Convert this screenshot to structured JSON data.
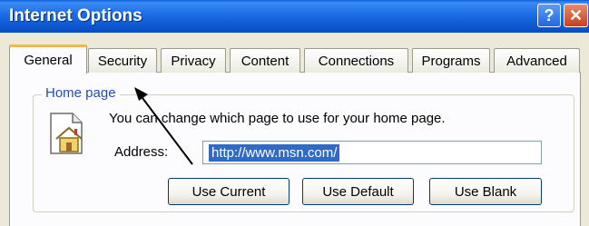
{
  "window": {
    "title": "Internet Options",
    "help_symbol": "?",
    "close_symbol": "✕"
  },
  "tabs": [
    {
      "label": "General",
      "active": true
    },
    {
      "label": "Security",
      "active": false
    },
    {
      "label": "Privacy",
      "active": false
    },
    {
      "label": "Content",
      "active": false
    },
    {
      "label": "Connections",
      "active": false
    },
    {
      "label": "Programs",
      "active": false
    },
    {
      "label": "Advanced",
      "active": false
    }
  ],
  "home_page": {
    "group_title": "Home page",
    "icon": "home-page-icon",
    "description": "You can change which page to use for your home page.",
    "address_label": "Address:",
    "address_value": "http://www.msn.com/",
    "buttons": {
      "use_current": "Use Current",
      "use_default": "Use Default",
      "use_blank": "Use Blank"
    }
  },
  "colors": {
    "titlebar": "#0b57d0",
    "active_tab_highlight": "#f7b64b",
    "group_title": "#1f4fb4",
    "selection": "#316ac5"
  }
}
